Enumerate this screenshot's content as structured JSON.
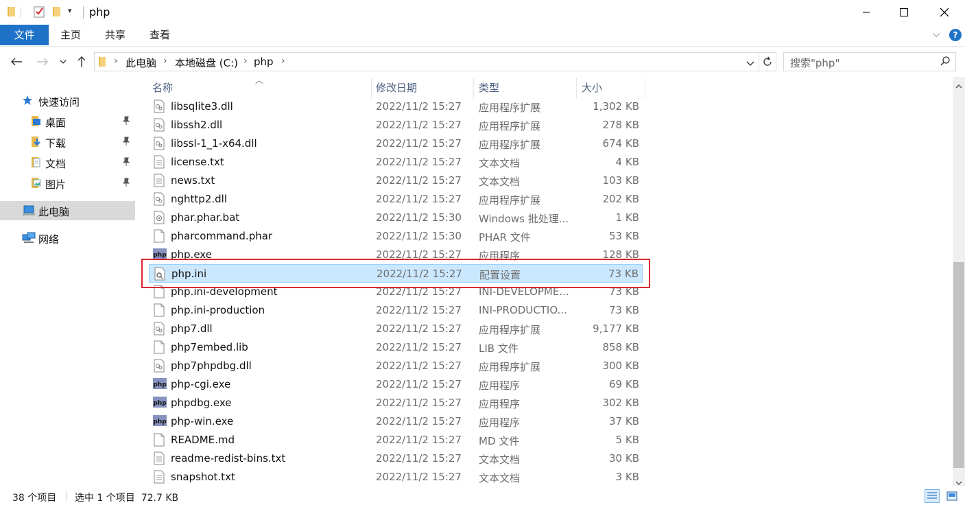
{
  "window": {
    "title": "php"
  },
  "ribbon": {
    "tabs": [
      "文件",
      "主页",
      "共享",
      "查看"
    ]
  },
  "address": {
    "crumbs": [
      "此电脑",
      "本地磁盘 (C:)",
      "php"
    ]
  },
  "search": {
    "placeholder": "搜索\"php\""
  },
  "nav": {
    "quick_access": "快速访问",
    "desktop": "桌面",
    "downloads": "下载",
    "documents": "文档",
    "pictures": "图片",
    "this_pc": "此电脑",
    "network": "网络"
  },
  "columns": {
    "name": "名称",
    "date": "修改日期",
    "type": "类型",
    "size": "大小"
  },
  "files": [
    {
      "name": "libsqlite3.dll",
      "date": "2022/11/2 15:27",
      "type": "应用程序扩展",
      "size": "1,302 KB",
      "icon": "dll-icon"
    },
    {
      "name": "libssh2.dll",
      "date": "2022/11/2 15:27",
      "type": "应用程序扩展",
      "size": "278 KB",
      "icon": "dll-icon"
    },
    {
      "name": "libssl-1_1-x64.dll",
      "date": "2022/11/2 15:27",
      "type": "应用程序扩展",
      "size": "674 KB",
      "icon": "dll-icon"
    },
    {
      "name": "license.txt",
      "date": "2022/11/2 15:27",
      "type": "文本文档",
      "size": "4 KB",
      "icon": "text-file-icon"
    },
    {
      "name": "news.txt",
      "date": "2022/11/2 15:27",
      "type": "文本文档",
      "size": "103 KB",
      "icon": "text-file-icon"
    },
    {
      "name": "nghttp2.dll",
      "date": "2022/11/2 15:27",
      "type": "应用程序扩展",
      "size": "202 KB",
      "icon": "dll-icon"
    },
    {
      "name": "phar.phar.bat",
      "date": "2022/11/2 15:30",
      "type": "Windows 批处理...",
      "size": "1 KB",
      "icon": "batch-file-icon"
    },
    {
      "name": "pharcommand.phar",
      "date": "2022/11/2 15:30",
      "type": "PHAR 文件",
      "size": "53 KB",
      "icon": "blank-file-icon"
    },
    {
      "name": "php.exe",
      "date": "2022/11/2 15:27",
      "type": "应用程序",
      "size": "128 KB",
      "icon": "php-exe-icon"
    },
    {
      "name": "php.ini",
      "date": "2022/11/2 15:27",
      "type": "配置设置",
      "size": "73 KB",
      "icon": "config-file-icon",
      "selected": true
    },
    {
      "name": "php.ini-development",
      "date": "2022/11/2 15:27",
      "type": "INI-DEVELOPME...",
      "size": "73 KB",
      "icon": "blank-file-icon"
    },
    {
      "name": "php.ini-production",
      "date": "2022/11/2 15:27",
      "type": "INI-PRODUCTIO...",
      "size": "73 KB",
      "icon": "blank-file-icon"
    },
    {
      "name": "php7.dll",
      "date": "2022/11/2 15:27",
      "type": "应用程序扩展",
      "size": "9,177 KB",
      "icon": "dll-icon"
    },
    {
      "name": "php7embed.lib",
      "date": "2022/11/2 15:27",
      "type": "LIB 文件",
      "size": "858 KB",
      "icon": "blank-file-icon"
    },
    {
      "name": "php7phpdbg.dll",
      "date": "2022/11/2 15:27",
      "type": "应用程序扩展",
      "size": "300 KB",
      "icon": "dll-icon"
    },
    {
      "name": "php-cgi.exe",
      "date": "2022/11/2 15:27",
      "type": "应用程序",
      "size": "69 KB",
      "icon": "php-exe-icon"
    },
    {
      "name": "phpdbg.exe",
      "date": "2022/11/2 15:27",
      "type": "应用程序",
      "size": "302 KB",
      "icon": "php-exe-icon"
    },
    {
      "name": "php-win.exe",
      "date": "2022/11/2 15:27",
      "type": "应用程序",
      "size": "37 KB",
      "icon": "php-exe-icon"
    },
    {
      "name": "README.md",
      "date": "2022/11/2 15:27",
      "type": "MD 文件",
      "size": "5 KB",
      "icon": "blank-file-icon"
    },
    {
      "name": "readme-redist-bins.txt",
      "date": "2022/11/2 15:27",
      "type": "文本文档",
      "size": "30 KB",
      "icon": "text-file-icon"
    },
    {
      "name": "snapshot.txt",
      "date": "2022/11/2 15:27",
      "type": "文本文档",
      "size": "3 KB",
      "icon": "text-file-icon"
    }
  ],
  "status": {
    "item_count": "38 个项目",
    "selection": "选中 1 个项目  72.7 KB"
  },
  "colors": {
    "accent": "#1e73c8",
    "selection_bg": "#cce8ff",
    "highlight_border": "#d9272e"
  }
}
